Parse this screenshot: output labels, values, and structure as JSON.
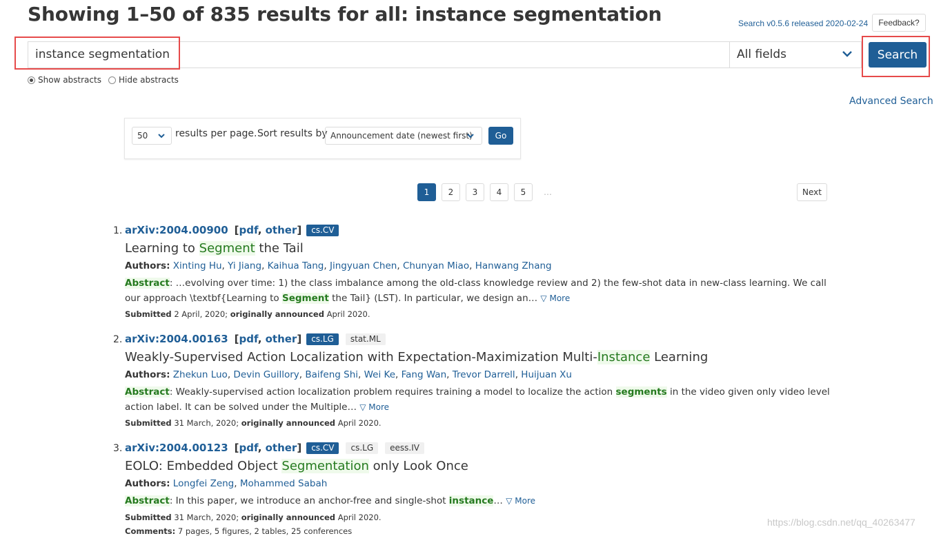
{
  "header": {
    "title": "Showing 1–50 of 835 results for all: instance segmentation",
    "version_link": "Search v0.5.6 released 2020-02-24",
    "feedback_label": "Feedback?"
  },
  "search": {
    "query": "instance segmentation",
    "field": "All fields",
    "button_label": "Search"
  },
  "abstract_toggle": {
    "show_label": "Show abstracts",
    "hide_label": "Hide abstracts",
    "selected": "show"
  },
  "advanced_search_label": "Advanced Search",
  "controls": {
    "per_page_value": "50",
    "per_page_label": "results per page.",
    "sort_label": "Sort results by",
    "sort_value": "Announcement date (newest first)",
    "go_label": "Go"
  },
  "pagination": {
    "pages": [
      "1",
      "2",
      "3",
      "4",
      "5"
    ],
    "current": "1",
    "ellipsis": "…",
    "next_label": "Next"
  },
  "results": [
    {
      "num": "1.",
      "id": "arXiv:2004.00900",
      "link_pdf": "pdf",
      "link_other": "other",
      "tags": [
        "cs.CV"
      ],
      "title_parts": [
        "Learning to ",
        "Segment",
        " the Tail"
      ],
      "authors_label": "Authors:",
      "authors": [
        "Xinting Hu",
        "Yi Jiang",
        "Kaihua Tang",
        "Jingyuan Chen",
        "Chunyan Miao",
        "Hanwang Zhang"
      ],
      "abstract_label": "Abstract",
      "abstract_parts": [
        ": …evolving over time: 1) the class imbalance among the old-class knowledge review and 2) the few-shot data in new-class learning. We call our approach \\textbf{Learning to ",
        "Segment",
        " the Tail} (LST). In particular, we design an… "
      ],
      "more_label": "▽ More",
      "submitted_label": "Submitted",
      "submitted": "2 April, 2020;",
      "announced_label": "originally announced",
      "announced": "April 2020."
    },
    {
      "num": "2.",
      "id": "arXiv:2004.00163",
      "link_pdf": "pdf",
      "link_other": "other",
      "tags": [
        "cs.LG",
        "stat.ML"
      ],
      "title_parts": [
        "Weakly-Supervised Action Localization with Expectation-Maximization Multi-",
        "Instance",
        " Learning"
      ],
      "authors_label": "Authors:",
      "authors": [
        "Zhekun Luo",
        "Devin Guillory",
        "Baifeng Shi",
        "Wei Ke",
        "Fang Wan",
        "Trevor Darrell",
        "Huijuan Xu"
      ],
      "abstract_label": "Abstract",
      "abstract_parts": [
        ": Weakly-supervised action localization problem requires training a model to localize the action ",
        "segments",
        " in the video given only video level action label. It can be solved under the Multiple… "
      ],
      "more_label": "▽ More",
      "submitted_label": "Submitted",
      "submitted": "31 March, 2020;",
      "announced_label": "originally announced",
      "announced": "April 2020."
    },
    {
      "num": "3.",
      "id": "arXiv:2004.00123",
      "link_pdf": "pdf",
      "link_other": "other",
      "tags": [
        "cs.CV",
        "cs.LG",
        "eess.IV"
      ],
      "title_parts": [
        "EOLO: Embedded Object ",
        "Segmentation",
        " only Look Once"
      ],
      "authors_label": "Authors:",
      "authors": [
        "Longfei Zeng",
        "Mohammed Sabah"
      ],
      "abstract_label": "Abstract",
      "abstract_parts": [
        ": In this paper, we introduce an anchor-free and single-shot ",
        "instance",
        "… "
      ],
      "more_label": "▽ More",
      "submitted_label": "Submitted",
      "submitted": "31 March, 2020;",
      "announced_label": "originally announced",
      "announced": "April 2020.",
      "comments_label": "Comments:",
      "comments": "7 pages, 5 figures, 2 tables, 25 conferences"
    }
  ],
  "watermark": "https://blog.csdn.net/qq_40263477",
  "colors": {
    "accent": "#1f5e96",
    "highlight_text": "#257a1f",
    "highlight_bg": "#effaeb",
    "annotation_box": "#e64a4a"
  }
}
